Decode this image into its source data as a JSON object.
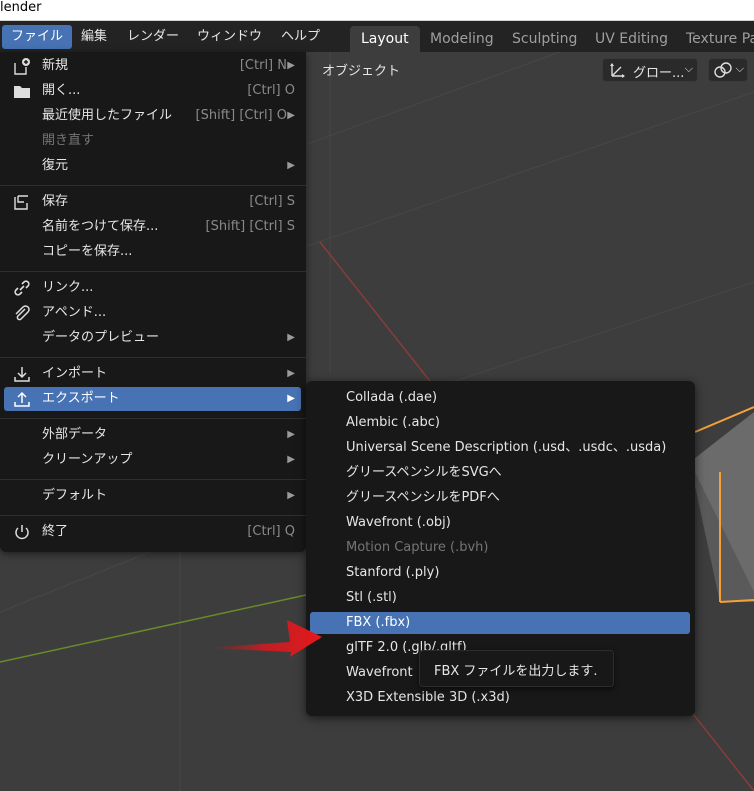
{
  "window": {
    "title": "lender"
  },
  "menubar": {
    "items": [
      {
        "label": "ファイル",
        "active": true
      },
      {
        "label": "編集"
      },
      {
        "label": "レンダー"
      },
      {
        "label": "ウィンドウ"
      },
      {
        "label": "ヘルプ"
      }
    ]
  },
  "workspaces": [
    {
      "label": "Layout",
      "active": true
    },
    {
      "label": "Modeling"
    },
    {
      "label": "Sculpting"
    },
    {
      "label": "UV Editing"
    },
    {
      "label": "Texture Pa"
    }
  ],
  "viewport_header": {
    "object_menu": "オブジェクト",
    "transform_orientation": "グロー...",
    "colors": {
      "accent": "#4772b3",
      "selection_outline": "#f5a13a"
    }
  },
  "file_menu": {
    "items": [
      {
        "label": "新規",
        "shortcut": "[Ctrl] N",
        "icon": "new-file-icon",
        "arrow": true
      },
      {
        "label": "開く...",
        "shortcut": "[Ctrl] O",
        "icon": "folder-icon"
      },
      {
        "label": "最近使用したファイル",
        "shortcut": "[Shift] [Ctrl] O",
        "arrow": true
      },
      {
        "label": "開き直す",
        "disabled": true
      },
      {
        "label": "復元",
        "arrow": true
      },
      {
        "label": "保存",
        "shortcut": "[Ctrl] S",
        "icon": "save-icon"
      },
      {
        "label": "名前をつけて保存...",
        "shortcut": "[Shift] [Ctrl] S"
      },
      {
        "label": "コピーを保存..."
      },
      {
        "label": "リンク...",
        "icon": "link-icon"
      },
      {
        "label": "アペンド...",
        "icon": "paperclip-icon"
      },
      {
        "label": "データのプレビュー",
        "arrow": true
      },
      {
        "label": "インポート",
        "icon": "import-icon",
        "arrow": true
      },
      {
        "label": "エクスポート",
        "icon": "export-icon",
        "arrow": true,
        "selected": true
      },
      {
        "label": "外部データ",
        "arrow": true
      },
      {
        "label": "クリーンアップ",
        "arrow": true
      },
      {
        "label": "デフォルト",
        "arrow": true
      },
      {
        "label": "終了",
        "shortcut": "[Ctrl] Q",
        "icon": "power-icon"
      }
    ]
  },
  "export_menu": {
    "items": [
      {
        "label": "Collada (.dae)"
      },
      {
        "label": "Alembic (.abc)"
      },
      {
        "label": "Universal Scene Description (.usd、.usdc、.usda)"
      },
      {
        "label": "グリースペンシルをSVGへ"
      },
      {
        "label": "グリースペンシルをPDFへ"
      },
      {
        "label": "Wavefront (.obj)"
      },
      {
        "label": "Motion Capture (.bvh)",
        "disabled": true
      },
      {
        "label": "Stanford (.ply)"
      },
      {
        "label": "Stl (.stl)"
      },
      {
        "label": "FBX (.fbx)",
        "selected": true
      },
      {
        "label": "glTF 2.0 (.glb/.gltf)"
      },
      {
        "label": "Wavefront"
      },
      {
        "label": "X3D Extensible 3D (.x3d)"
      }
    ]
  },
  "tooltip": {
    "text": "FBX ファイルを出力します."
  }
}
